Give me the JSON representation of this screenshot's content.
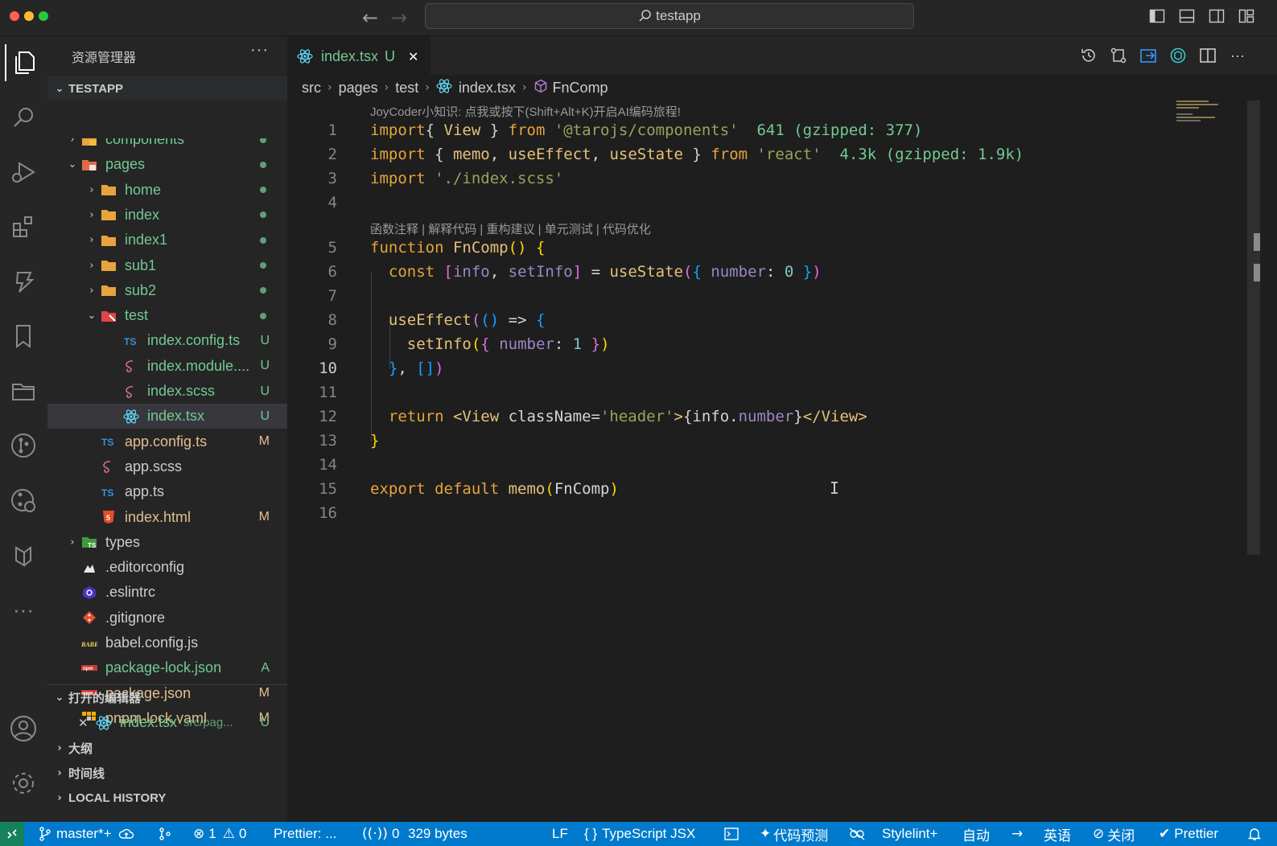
{
  "window": {
    "search_text": "testapp"
  },
  "sidebar": {
    "title": "资源管理器",
    "more": "···",
    "project": "TESTAPP",
    "tree": [
      {
        "name": "components",
        "kind": "folder-comp",
        "indent": 1,
        "chev": "›",
        "dot": true
      },
      {
        "name": "pages",
        "kind": "folder-pages",
        "indent": 1,
        "chev": "⌄",
        "dot": true
      },
      {
        "name": "home",
        "kind": "folder",
        "indent": 2,
        "chev": "›",
        "dot": true
      },
      {
        "name": "index",
        "kind": "folder",
        "indent": 2,
        "chev": "›",
        "dot": true
      },
      {
        "name": "index1",
        "kind": "folder",
        "indent": 2,
        "chev": "›",
        "dot": true
      },
      {
        "name": "sub1",
        "kind": "folder",
        "indent": 2,
        "chev": "›",
        "dot": true
      },
      {
        "name": "sub2",
        "kind": "folder",
        "indent": 2,
        "chev": "›",
        "dot": true
      },
      {
        "name": "test",
        "kind": "folder-test",
        "indent": 2,
        "chev": "⌄",
        "dot": true
      },
      {
        "name": "index.config.ts",
        "kind": "ts",
        "indent": 3,
        "badge": "U"
      },
      {
        "name": "index.module....",
        "kind": "scss",
        "indent": 3,
        "badge": "U"
      },
      {
        "name": "index.scss",
        "kind": "scss",
        "indent": 3,
        "badge": "U"
      },
      {
        "name": "index.tsx",
        "kind": "react",
        "indent": 3,
        "badge": "U",
        "selected": true
      },
      {
        "name": "app.config.ts",
        "kind": "ts",
        "indent": 2,
        "badge": "M"
      },
      {
        "name": "app.scss",
        "kind": "scss",
        "indent": 2
      },
      {
        "name": "app.ts",
        "kind": "ts",
        "indent": 2
      },
      {
        "name": "index.html",
        "kind": "html",
        "indent": 2,
        "badge": "M"
      },
      {
        "name": "types",
        "kind": "folder-types",
        "indent": 1,
        "chev": "›"
      },
      {
        "name": ".editorconfig",
        "kind": "editorconfig",
        "indent": 1
      },
      {
        "name": ".eslintrc",
        "kind": "eslint",
        "indent": 1
      },
      {
        "name": ".gitignore",
        "kind": "git",
        "indent": 1
      },
      {
        "name": "babel.config.js",
        "kind": "babel",
        "indent": 1
      },
      {
        "name": "package-lock.json",
        "kind": "npm",
        "indent": 1,
        "badge": "A"
      },
      {
        "name": "package.json",
        "kind": "npm",
        "indent": 1,
        "badge": "M"
      },
      {
        "name": "pnpm-lock.yaml",
        "kind": "pnpm",
        "indent": 1,
        "badge": "M"
      }
    ],
    "open_editors": {
      "title": "打开的编辑器",
      "file": "index.tsx",
      "path": "src/pag...",
      "badge": "U"
    },
    "outline": "大纲",
    "timeline": "时间线",
    "local_history": "LOCAL HISTORY"
  },
  "editor": {
    "tab": {
      "name": "index.tsx",
      "badge": "U",
      "close": "✕"
    },
    "breadcrumb": [
      "src",
      "pages",
      "test",
      "index.tsx",
      "FnComp"
    ],
    "hint_top": "JoyCoder小知识: 点我或按下(Shift+Alt+K)开启AI编码旅程!",
    "hint_codelens": "函数注释 | 解释代码 | 重构建议 | 单元测试 | 代码优化",
    "current_line": "10",
    "line_numbers": [
      "1",
      "2",
      "3",
      "4",
      "5",
      "6",
      "7",
      "8",
      "9",
      "10",
      "11",
      "12",
      "13",
      "14",
      "15",
      "16"
    ],
    "size_hints": [
      "641 (gzipped: 377)",
      "4.3k (gzipped: 1.9k)"
    ],
    "lines": [
      [
        [
          "kw",
          "import"
        ],
        [
          "",
          "{ "
        ],
        [
          "fn",
          "View"
        ],
        [
          "",
          " } "
        ],
        [
          "kw",
          "from"
        ],
        [
          "",
          ""
        ],
        [
          "str",
          " '@tarojs/components'"
        ]
      ],
      [
        [
          "kw",
          "import"
        ],
        [
          "",
          " { "
        ],
        [
          "fn",
          "memo"
        ],
        [
          "",
          ", "
        ],
        [
          "fn",
          "useEffect"
        ],
        [
          "",
          ", "
        ],
        [
          "fn",
          "useState"
        ],
        [
          "",
          " } "
        ],
        [
          "kw",
          "from"
        ],
        [
          "str",
          " 'react'"
        ]
      ],
      [
        [
          "kw",
          "import"
        ],
        [
          "str",
          " './index.scss'"
        ]
      ],
      [],
      [
        [
          "kw",
          "function"
        ],
        [
          "fn",
          " FnComp"
        ],
        [
          "br1",
          "()"
        ],
        [
          "",
          " "
        ],
        [
          "br1",
          "{"
        ]
      ],
      [
        [
          "",
          ""
        ],
        [
          "kw",
          "  const "
        ],
        [
          "br2",
          "["
        ],
        [
          "var",
          "info"
        ],
        [
          "",
          ", "
        ],
        [
          "var",
          "setInfo"
        ],
        [
          "br2",
          "]"
        ],
        [
          "",
          " = "
        ],
        [
          "fn",
          "useState"
        ],
        [
          "br2",
          "("
        ],
        [
          "br3",
          "{ "
        ],
        [
          "var",
          "number"
        ],
        [
          "",
          ": "
        ],
        [
          "num",
          "0"
        ],
        [
          "br3",
          " }"
        ],
        [
          "br2",
          ")"
        ]
      ],
      [],
      [
        [
          "fn",
          "  useEffect"
        ],
        [
          "br2",
          "("
        ],
        [
          "br3",
          "()"
        ],
        [
          "",
          ""
        ],
        [
          "",
          " => "
        ],
        [
          "br3",
          "{"
        ]
      ],
      [
        [
          "fn",
          "    setInfo"
        ],
        [
          "br1",
          "("
        ],
        [
          "br2",
          "{ "
        ],
        [
          "var",
          "number"
        ],
        [
          "",
          ": "
        ],
        [
          "num",
          "1"
        ],
        [
          "br2",
          " }"
        ],
        [
          "br1",
          ")"
        ]
      ],
      [
        [
          "br3",
          "  }"
        ],
        [
          "",
          ", "
        ],
        [
          "br3",
          "[]"
        ],
        [
          "br2",
          ")"
        ]
      ],
      [],
      [
        [
          "kw",
          "  return "
        ],
        [
          "tag",
          "<View "
        ],
        [
          "",
          "className="
        ],
        [
          "str",
          "'header'"
        ],
        [
          "tag",
          ">"
        ],
        [
          "",
          "{"
        ],
        [
          "",
          "info."
        ],
        [
          "var",
          "number"
        ],
        [
          "",
          "}"
        ],
        [
          "tag",
          "</View>"
        ]
      ],
      [
        [
          "br1",
          "}"
        ]
      ],
      [],
      [
        [
          "kw",
          "export default "
        ],
        [
          "fn",
          "memo"
        ],
        [
          "br1",
          "("
        ],
        [
          "",
          "FnComp"
        ],
        [
          "br1",
          ")"
        ]
      ],
      []
    ]
  },
  "statusbar": {
    "branch": "master*+",
    "errors": "1",
    "warnings": "0",
    "prettier_status": "Prettier: ...",
    "ports": "0",
    "size": "329 bytes",
    "eol": "LF",
    "language": "TypeScript JSX",
    "code_predict": "代码预测",
    "stylelint": "Stylelint+",
    "auto": "自动",
    "lang_en": "英语",
    "close": "关闭",
    "prettier": "Prettier"
  },
  "colors": {
    "accent": "#007acc",
    "untracked": "#73c991",
    "modified": "#e2c08d"
  }
}
